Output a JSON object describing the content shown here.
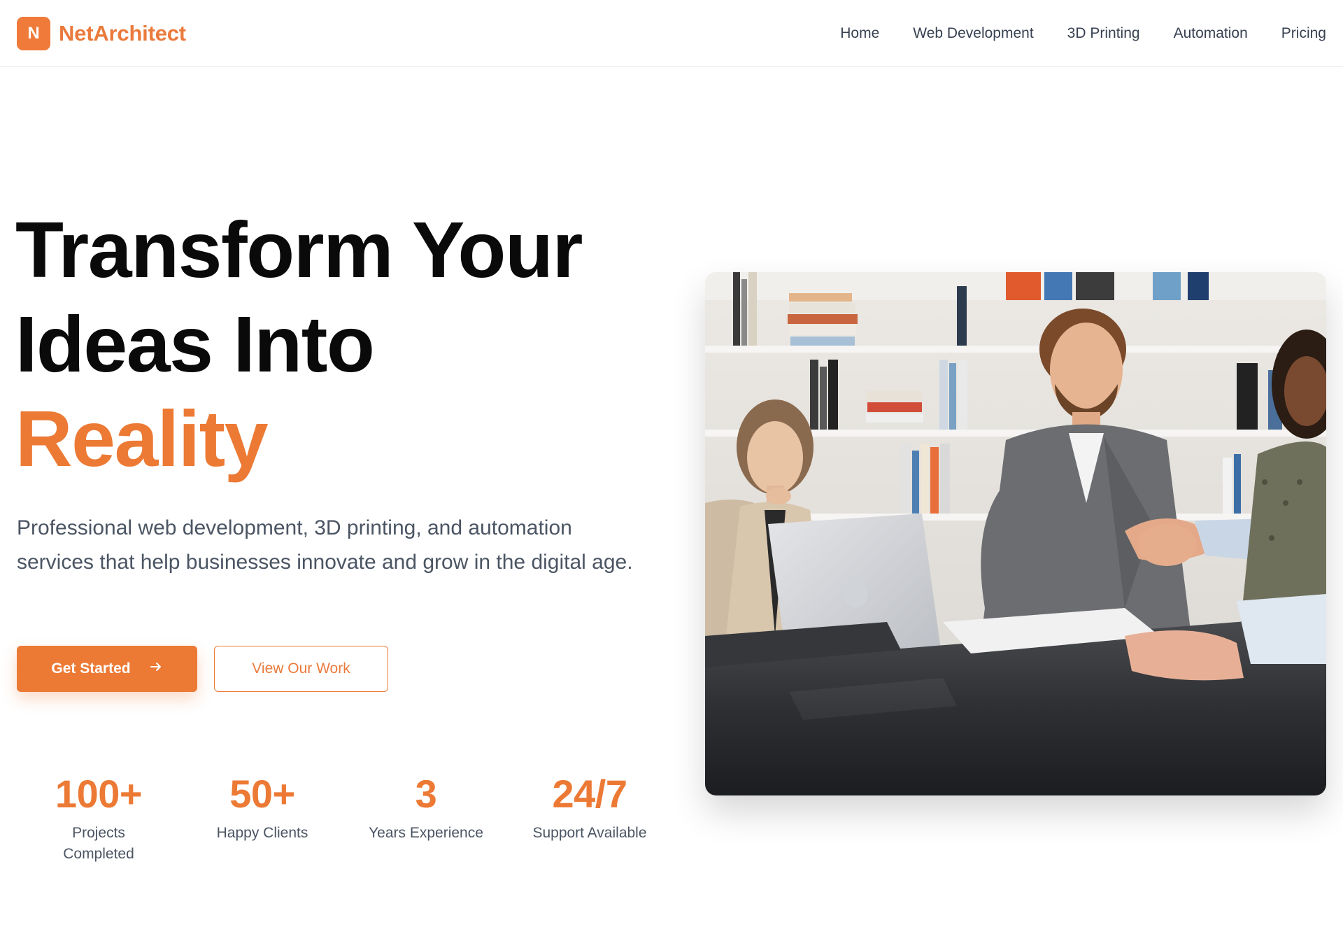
{
  "brand": {
    "initial": "N",
    "name": "NetArchitect"
  },
  "nav": {
    "items": [
      {
        "label": "Home"
      },
      {
        "label": "Web Development"
      },
      {
        "label": "3D Printing"
      },
      {
        "label": "Automation"
      },
      {
        "label": "Pricing"
      }
    ]
  },
  "hero": {
    "title_line1": "Transform Your",
    "title_line2": "Ideas Into",
    "title_accent": "Reality",
    "subtitle": "Professional web development, 3D printing, and automation services that help businesses innovate and grow in the digital age.",
    "primary_cta": "Get Started",
    "primary_cta_icon": "arrow-right-icon",
    "secondary_cta": "View Our Work",
    "image_alt": "Team meeting with a handshake across a conference table"
  },
  "stats": [
    {
      "value": "100+",
      "label": "Projects Completed"
    },
    {
      "value": "50+",
      "label": "Happy Clients"
    },
    {
      "value": "3",
      "label": "Years Experience"
    },
    {
      "value": "24/7",
      "label": "Support Available"
    }
  ],
  "colors": {
    "accent": "#ec7a35",
    "text_dark": "#0a0a0a",
    "text_muted": "#4b5563",
    "border": "#e5e7eb"
  }
}
